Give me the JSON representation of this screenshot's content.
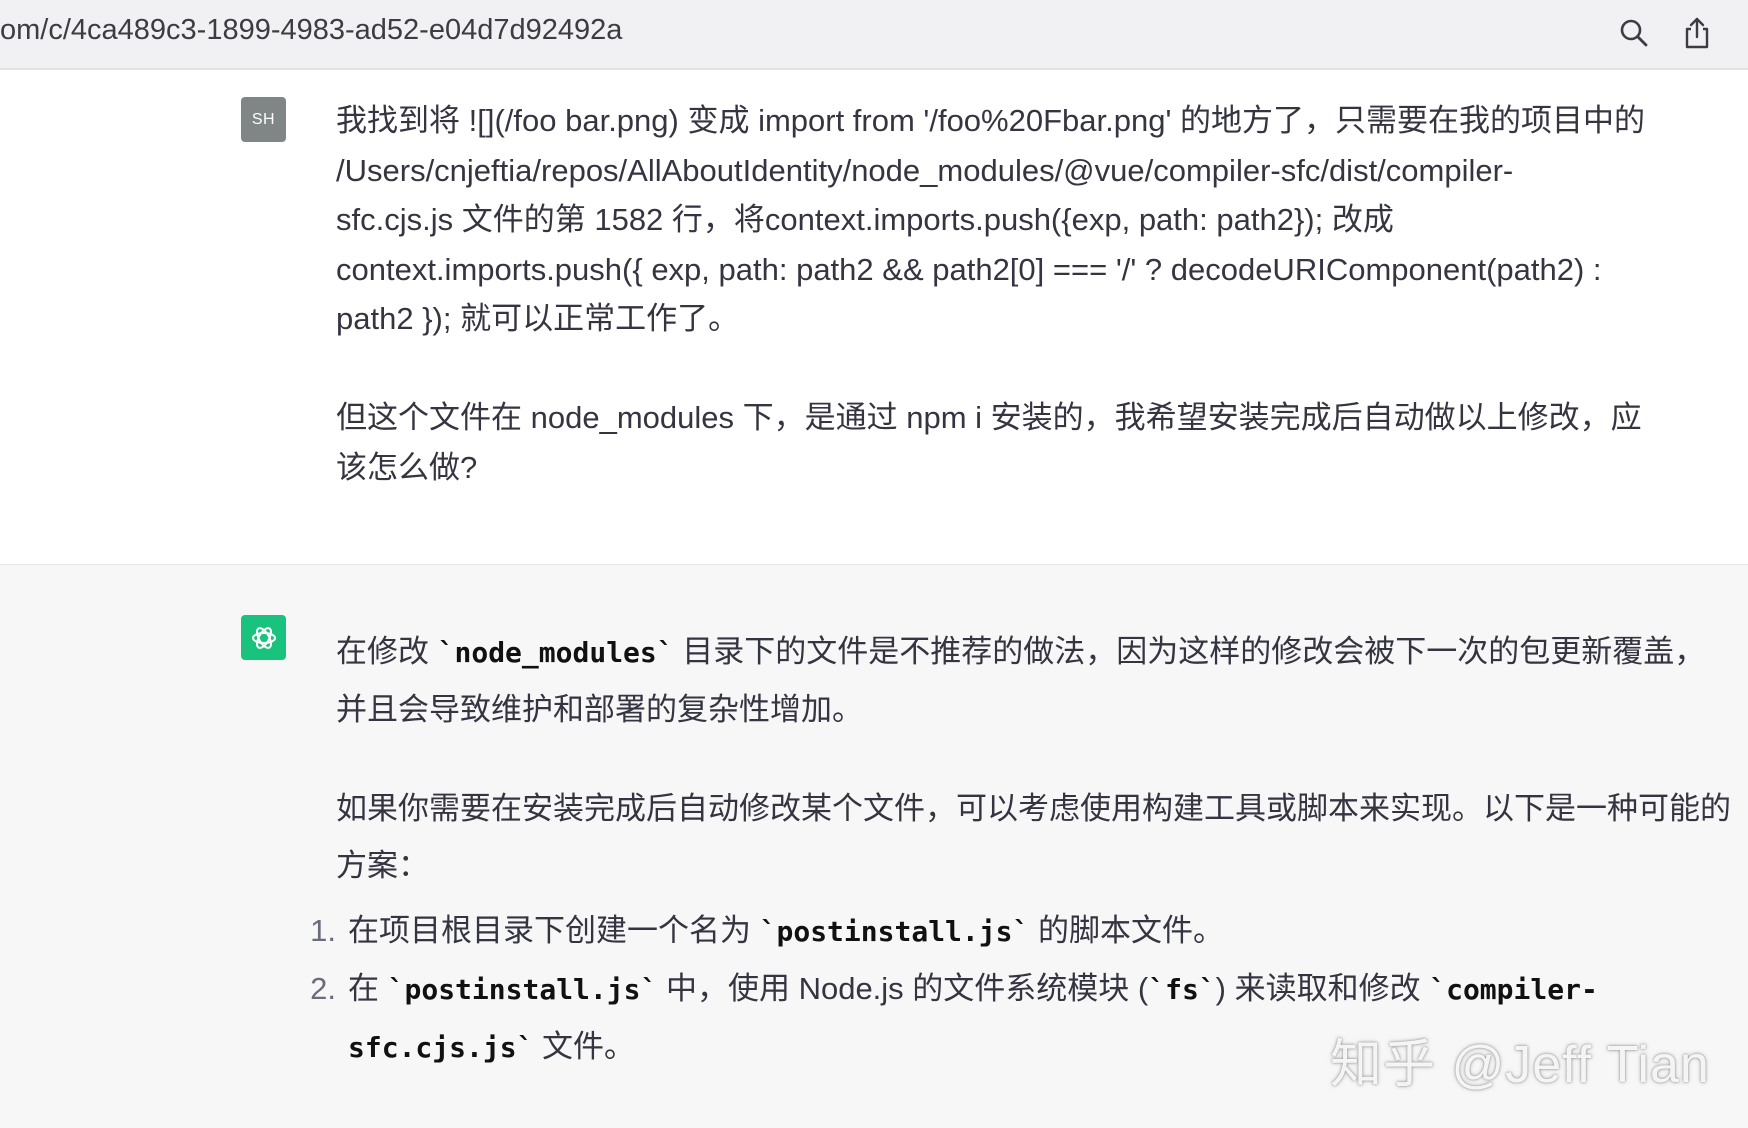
{
  "urlbar": {
    "url": "om/c/4ca489c3-1899-4983-ad52-e04d7d92492a",
    "icons": [
      "search-icon",
      "share-icon"
    ]
  },
  "user": {
    "avatar_initials": "SH",
    "para1": "我找到将 ![](/foo bar.png) 变成 import from '/foo%20Fbar.png' 的地方了，只需要在我的项目中的\n/Users/cnjeftia/repos/AllAboutIdentity/node_modules/@vue/compiler-sfc/dist/compiler-\nsfc.cjs.js 文件的第 1582 行，将context.imports.push({exp, path: path2}); 改成\ncontext.imports.push({ exp, path: path2 && path2[0] === '/' ? decodeURIComponent(path2) :\npath2 }); 就可以正常工作了。",
    "para2": "但这个文件在 node_modules 下，是通过 npm i 安装的，我希望安装完成后自动做以上修改，应\n该怎么做?"
  },
  "assistant": {
    "avatar_icon": "openai-logo-icon",
    "p1_pre": "在修改 ",
    "p1_code": "`node_modules`",
    "p1_post": " 目录下的文件是不推荐的做法，因为这样的修改会被下一次的包更新覆盖，并且会导致维护和部署的复杂性增加。",
    "p2": "如果你需要在安装完成后自动修改某个文件，可以考虑使用构建工具或脚本来实现。以下是一种可能的方案：",
    "steps": [
      {
        "num": "1.",
        "pre": "在项目根目录下创建一个名为 ",
        "code": "`postinstall.js`",
        "post": " 的脚本文件。"
      },
      {
        "num": "2.",
        "pre": "在 ",
        "code": "`postinstall.js`",
        "mid": " 中，使用 Node.js 的文件系统模块 (",
        "code2": "`fs`",
        "mid2": ") 来读取和修改 ",
        "code3": "`compiler-sfc.cjs.js`",
        "post": " 文件。"
      }
    ]
  },
  "watermark": "知乎 @Jeff Tian"
}
